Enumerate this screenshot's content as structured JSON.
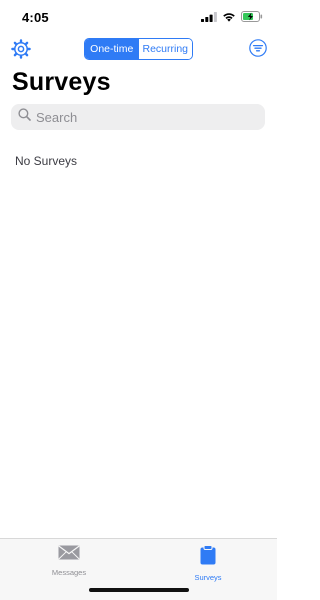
{
  "status_bar": {
    "time": "4:05",
    "icons": [
      "cellular-signal-icon",
      "wifi-icon",
      "battery-charging-icon"
    ]
  },
  "nav": {
    "settings_icon": "gear-icon",
    "segments": [
      {
        "label": "One-time",
        "selected": true
      },
      {
        "label": "Recurring",
        "selected": false
      }
    ],
    "filter_icon": "filter-icon"
  },
  "page": {
    "title": "Surveys",
    "search_placeholder": "Search",
    "empty_message": "No Surveys"
  },
  "tab_bar": {
    "tabs": [
      {
        "label": "Messages",
        "icon": "envelope-icon",
        "selected": false
      },
      {
        "label": "Surveys",
        "icon": "clipboard-icon",
        "selected": true
      }
    ]
  },
  "colors": {
    "accent": "#2f7bf5",
    "inactive": "#8e8e93",
    "search_bg": "#eeeeef"
  }
}
